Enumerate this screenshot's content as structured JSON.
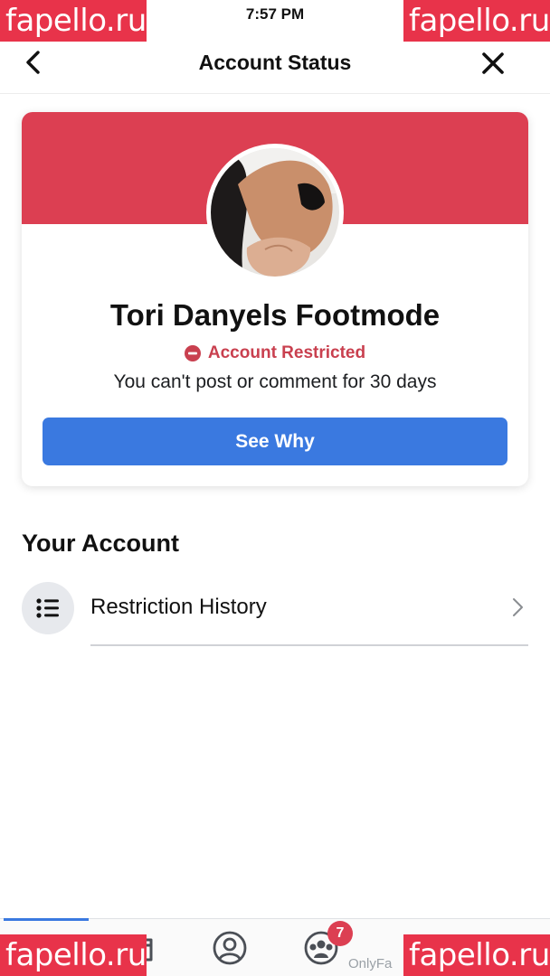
{
  "status_bar": {
    "time": "7:57 PM"
  },
  "header": {
    "title": "Account Status",
    "back_icon": "chevron-left-icon",
    "close_icon": "close-icon"
  },
  "status_card": {
    "banner_color": "#dc3f52",
    "profile_name": "Tori Danyels Footmode",
    "restriction_label": "Account Restricted",
    "restriction_icon": "no-entry-icon",
    "restriction_description": "You can't post or comment for 30 days",
    "button_label": "See Why",
    "button_color": "#3a79e0"
  },
  "your_account": {
    "title": "Your Account",
    "items": [
      {
        "label": "Restriction History",
        "icon": "list-icon"
      }
    ]
  },
  "tab_bar": {
    "tabs": [
      {
        "icon": "home-icon"
      },
      {
        "icon": "marketplace-icon"
      },
      {
        "icon": "profile-icon"
      },
      {
        "icon": "groups-icon",
        "badge": "7"
      },
      {
        "icon": "notifications-icon"
      }
    ]
  },
  "footer_caption": "OnlyFa",
  "watermark": {
    "text": "fapello.ru"
  },
  "colors": {
    "accent": "#3a79e0",
    "restriction": "#c9404f",
    "watermark": "#e8334a"
  }
}
